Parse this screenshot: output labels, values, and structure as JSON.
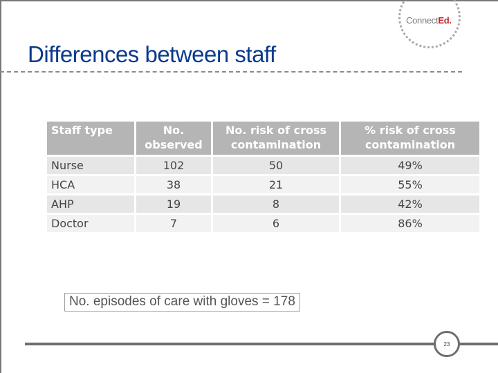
{
  "logo": {
    "text_main": "Connect",
    "text_accent": "Ed."
  },
  "title": "Differences between staff",
  "table": {
    "headers": [
      "Staff type",
      "No. observed",
      "No. risk of cross contamination",
      "% risk of cross contamination"
    ],
    "header_lines": [
      [
        "Staff type"
      ],
      [
        "No.",
        "observed"
      ],
      [
        "No. risk of cross",
        "contamination"
      ],
      [
        "% risk of cross",
        "contamination"
      ]
    ],
    "rows": [
      [
        "Nurse",
        "102",
        "50",
        "49%"
      ],
      [
        "HCA",
        "38",
        "21",
        "55%"
      ],
      [
        "AHP",
        "19",
        "8",
        "42%"
      ],
      [
        "Doctor",
        "7",
        "6",
        "86%"
      ]
    ]
  },
  "note": "No. episodes of care with gloves = 178",
  "page_number": "23"
}
